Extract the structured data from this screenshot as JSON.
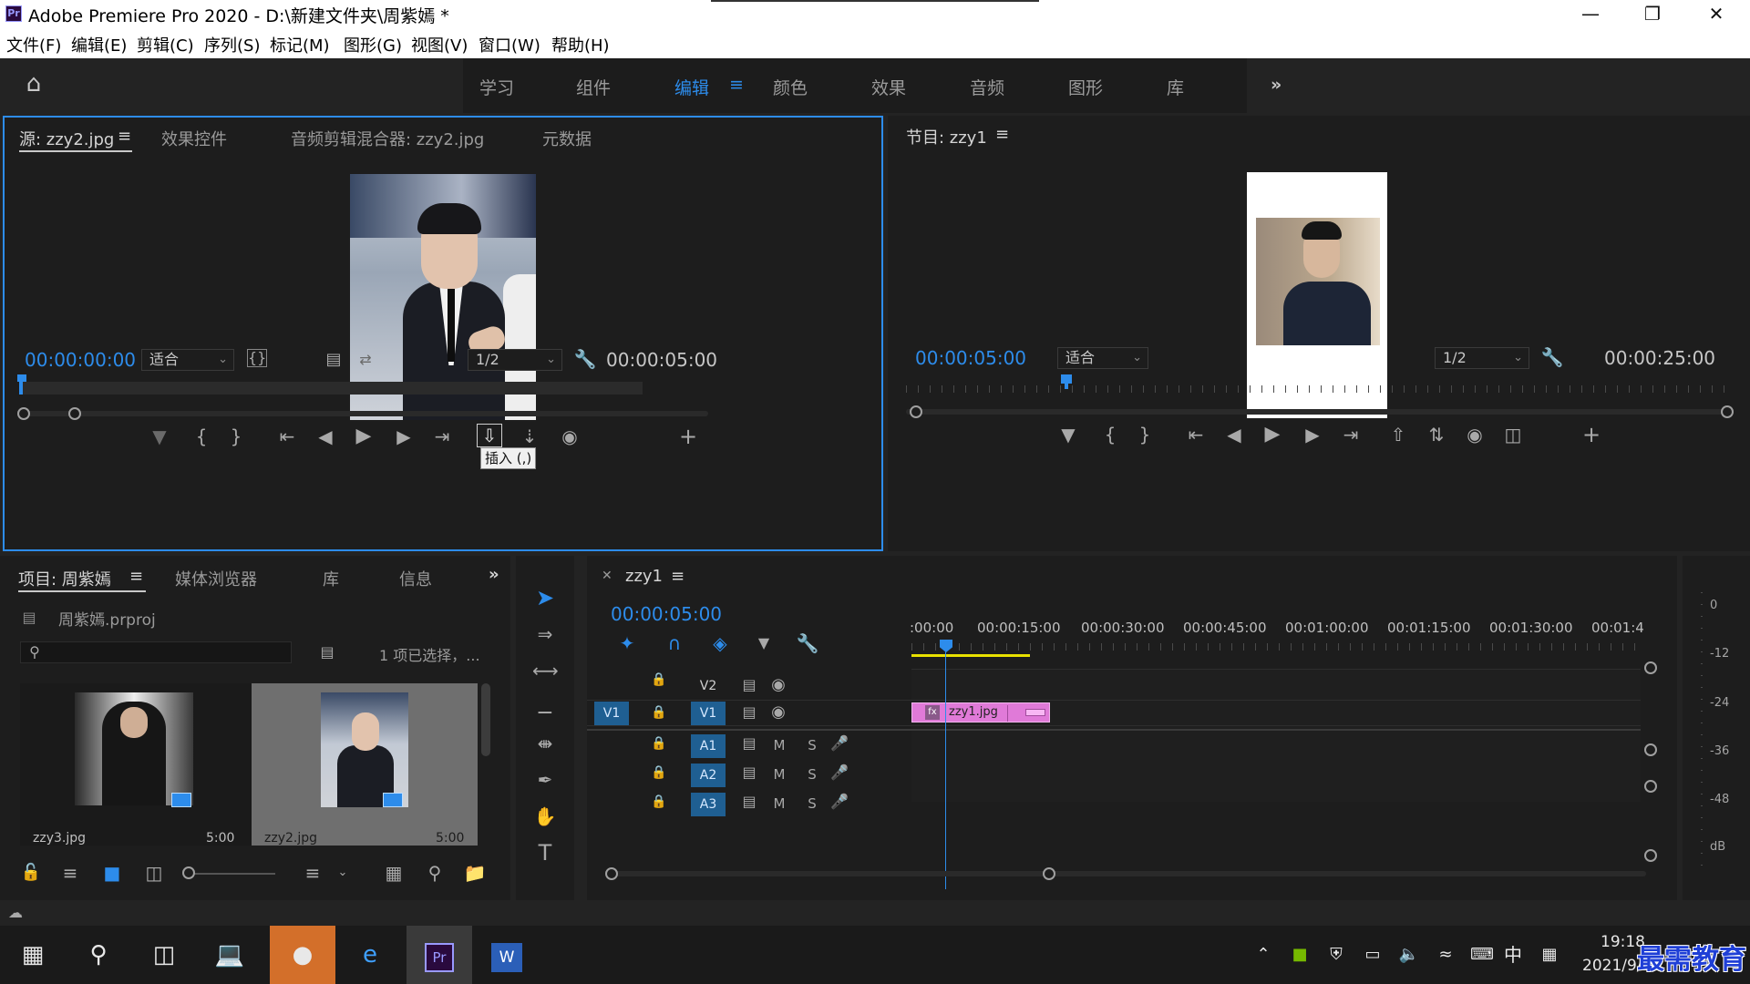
{
  "window": {
    "title": "Adobe Premiere Pro 2020 - D:\\新建文件夹\\周紫嫣 *",
    "app_icon": "Pr",
    "controls": [
      "minimize-icon",
      "restore-icon",
      "close-icon"
    ]
  },
  "menu": [
    "文件(F)",
    "编辑(E)",
    "剪辑(C)",
    "序列(S)",
    "标记(M)",
    "图形(G)",
    "视图(V)",
    "窗口(W)",
    "帮助(H)"
  ],
  "workspaces": {
    "tabs": [
      "学习",
      "组件",
      "编辑",
      "颜色",
      "效果",
      "音频",
      "图形",
      "库"
    ],
    "active": "编辑",
    "more": "»"
  },
  "source_monitor": {
    "tabs": [
      "源: zzy2.jpg",
      "效果控件",
      "音频剪辑混合器: zzy2.jpg",
      "元数据"
    ],
    "timecode_current": "00:00:00:00",
    "fit": "适合",
    "resolution": "1/2",
    "timecode_duration": "00:00:05:00",
    "tooltip": "插入 (,)"
  },
  "program_monitor": {
    "tab": "节目: zzy1",
    "timecode_current": "00:00:05:00",
    "fit": "适合",
    "resolution": "1/2",
    "timecode_duration": "00:00:25:00"
  },
  "project_panel": {
    "tabs": [
      "项目: 周紫嫣",
      "媒体浏览器",
      "库",
      "信息"
    ],
    "project_file": "周紫嫣.prproj",
    "search_placeholder": "",
    "selection_status": "1 项已选择，...",
    "items": [
      {
        "name": "zzy3.jpg",
        "duration": "5:00"
      },
      {
        "name": "zzy2.jpg",
        "duration": "5:00"
      }
    ]
  },
  "timeline": {
    "sequence": "zzy1",
    "timecode": "00:00:05:00",
    "ruler_labels": [
      ":00:00",
      "00:00:15:00",
      "00:00:30:00",
      "00:00:45:00",
      "00:01:00:00",
      "00:01:15:00",
      "00:01:30:00",
      "00:01:4"
    ],
    "tracks": [
      {
        "id": "V2",
        "type": "video"
      },
      {
        "id": "V1",
        "type": "video",
        "source_patch": "V1"
      },
      {
        "id": "A1",
        "type": "audio",
        "m": "M",
        "s": "S"
      },
      {
        "id": "A2",
        "type": "audio",
        "m": "M",
        "s": "S"
      },
      {
        "id": "A3",
        "type": "audio",
        "m": "M",
        "s": "S"
      }
    ],
    "clip": {
      "name": "zzy1.jpg",
      "badge": "fx",
      "color": "#e07ad8"
    }
  },
  "audio_meter": {
    "labels": [
      "0",
      "-12",
      "-24",
      "-36",
      "-48",
      "dB"
    ]
  },
  "taskbar": {
    "clock_time": "19:18",
    "clock_date": "2021/9/26",
    "ime": "中",
    "watermark": "最需教育"
  },
  "colors": {
    "accent": "#2d8ceb",
    "clip": "#e07ad8",
    "in_out_bar": "#e8e000"
  }
}
